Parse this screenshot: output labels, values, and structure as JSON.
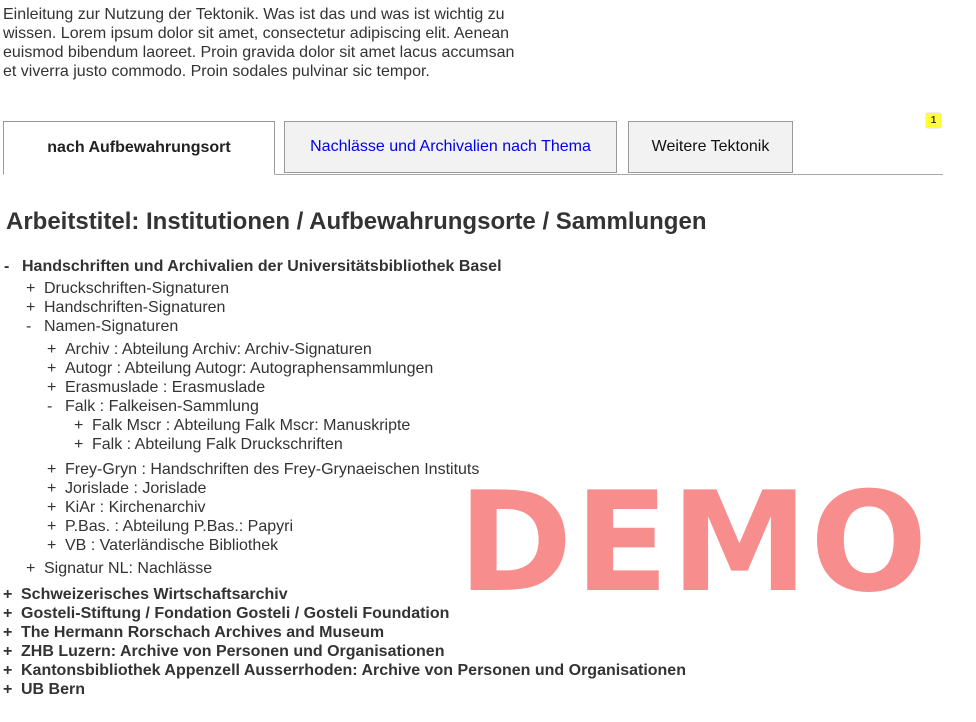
{
  "intro": {
    "lines": [
      "Einleitung zur Nutzung der Tektonik. Was ist das und was ist wichtig zu",
      "wissen. Lorem ipsum dolor sit amet, consectetur adipiscing elit. Aenean",
      "euismod bibendum laoreet. Proin gravida dolor sit amet lacus accumsan",
      "et viverra justo commodo. Proin sodales pulvinar sic tempor."
    ]
  },
  "tabs": [
    {
      "label": "nach Aufbewahrungsort"
    },
    {
      "label": "Nachlässe und Archivalien nach Thema"
    },
    {
      "label": "Weitere Tektonik"
    }
  ],
  "badge": "1",
  "heading": "Arbeitstitel: Institutionen / Aufbewahrungsorte / Sammlungen",
  "tree": {
    "root": {
      "toggle": "-",
      "label": "Handschriften und Archivalien der Universitätsbibliothek Basel"
    },
    "level1": [
      {
        "toggle": "+",
        "label": "Druckschriften-Signaturen"
      },
      {
        "toggle": "+",
        "label": "Handschriften-Signaturen"
      },
      {
        "toggle": "-",
        "label": "Namen-Signaturen"
      }
    ],
    "names": [
      {
        "toggle": "+",
        "label": "Archiv : Abteilung Archiv: Archiv-Signaturen"
      },
      {
        "toggle": "+",
        "label": "Autogr : Abteilung Autogr: Autographensammlungen"
      },
      {
        "toggle": "+",
        "label": "Erasmuslade : Erasmuslade"
      },
      {
        "toggle": "-",
        "label": "Falk : Falkeisen-Sammlung"
      }
    ],
    "falk": [
      {
        "toggle": "+",
        "label": "Falk Mscr : Abteilung Falk Mscr: Manuskripte"
      },
      {
        "toggle": "+",
        "label": "Falk : Abteilung Falk Druckschriften"
      }
    ],
    "names2": [
      {
        "toggle": "+",
        "label": "Frey-Gryn : Handschriften des Frey-Grynaeischen Instituts"
      },
      {
        "toggle": "+",
        "label": "Jorislade : Jorislade"
      },
      {
        "toggle": "+",
        "label": "KiAr : Kirchenarchiv"
      },
      {
        "toggle": "+",
        "label": "P.Bas. : Abteilung P.Bas.: Papyri"
      },
      {
        "toggle": "+",
        "label": "VB : Vaterländische Bibliothek"
      }
    ],
    "signatur": {
      "toggle": "+",
      "label": "Signatur NL: Nachlässe"
    },
    "top": [
      {
        "toggle": "+",
        "label": "Schweizerisches Wirtschaftsarchiv"
      },
      {
        "toggle": "+",
        "label": "Gosteli-Stiftung / Fondation Gosteli / Gosteli Foundation"
      },
      {
        "toggle": "+",
        "label": "The Hermann Rorschach Archives and Museum"
      },
      {
        "toggle": "+",
        "label": "ZHB Luzern: Archive von Personen und Organisationen"
      },
      {
        "toggle": "+",
        "label": "Kantonsbibliothek Appenzell Ausserrhoden: Archive von Personen und Organisationen"
      },
      {
        "toggle": "+",
        "label": "UB Bern"
      }
    ]
  },
  "watermark": "DEMO"
}
